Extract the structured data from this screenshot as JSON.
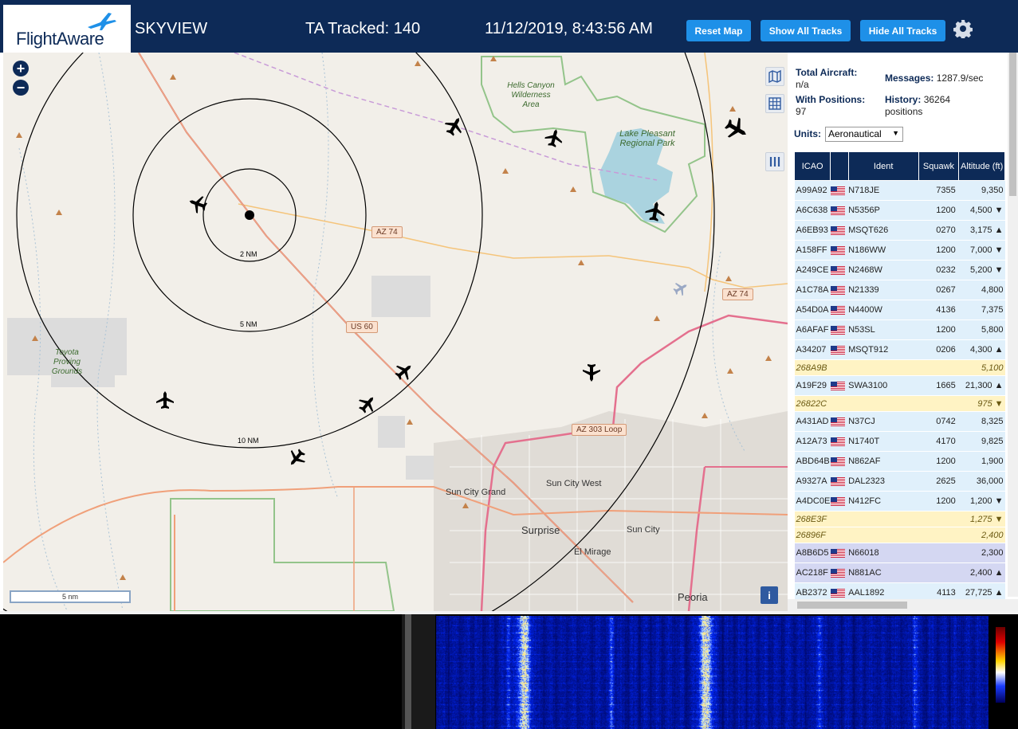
{
  "header": {
    "logo_text": "FlightAware",
    "title": "SKYVIEW",
    "tracked": "TA Tracked: 140",
    "datetime": "11/12/2019, 8:43:56 AM",
    "reset_map": "Reset Map",
    "show_all": "Show All Tracks",
    "hide_all": "Hide All Tracks"
  },
  "map": {
    "zoom_in": "+",
    "zoom_out": "−",
    "ring_labels": [
      "2 NM",
      "5 NM",
      "10 NM"
    ],
    "shields": [
      "AZ 74",
      "AZ 74",
      "US 60",
      "AZ 303 Loop"
    ],
    "places": [
      "Sun City Grand",
      "Sun City West",
      "Surprise",
      "Sun City",
      "El Mirage",
      "Peoria"
    ],
    "parks": [
      "Hells Canyon Wilderness Area",
      "Lake Pleasant Regional Park",
      "Toyota Proving Grounds"
    ],
    "scale_label": "5 nm",
    "info": "i"
  },
  "stats": {
    "total_label": "Total Aircraft:",
    "total_value": "n/a",
    "messages_label": "Messages:",
    "messages_value": "1287.9/sec",
    "positions_label": "With Positions:",
    "positions_value": "97",
    "history_label": "History:",
    "history_value": "36264 positions"
  },
  "units": {
    "label": "Units:",
    "value": "Aeronautical"
  },
  "table": {
    "headers": [
      "ICAO",
      "",
      "Ident",
      "Squawk",
      "Altitude (ft)"
    ],
    "rows": [
      {
        "icao": "A99A92",
        "ident": "N718JE",
        "squawk": "7355",
        "alt": "9,350",
        "type": "blue",
        "flag": true
      },
      {
        "icao": "A6C638",
        "ident": "N5356P",
        "squawk": "1200",
        "alt": "4,500 ▼",
        "type": "blue",
        "flag": true
      },
      {
        "icao": "A6EB93",
        "ident": "MSQT626",
        "squawk": "0270",
        "alt": "3,175 ▲",
        "type": "blue",
        "flag": true
      },
      {
        "icao": "A158FF",
        "ident": "N186WW",
        "squawk": "1200",
        "alt": "7,000 ▼",
        "type": "blue",
        "flag": true
      },
      {
        "icao": "A249CE",
        "ident": "N2468W",
        "squawk": "0232",
        "alt": "5,200 ▼",
        "type": "blue",
        "flag": true
      },
      {
        "icao": "A1C78A",
        "ident": "N21339",
        "squawk": "0267",
        "alt": "4,800",
        "type": "blue",
        "flag": true
      },
      {
        "icao": "A54D0A",
        "ident": "N4400W",
        "squawk": "4136",
        "alt": "7,375",
        "type": "blue",
        "flag": true
      },
      {
        "icao": "A6AFAF",
        "ident": "N53SL",
        "squawk": "1200",
        "alt": "5,800",
        "type": "blue",
        "flag": true
      },
      {
        "icao": "A34207",
        "ident": "MSQT912",
        "squawk": "0206",
        "alt": "4,300 ▲",
        "type": "blue",
        "flag": true
      },
      {
        "icao": "268A9B",
        "ident": "",
        "squawk": "",
        "alt": "5,100",
        "type": "yellow",
        "flag": false
      },
      {
        "icao": "A19F29",
        "ident": "SWA3100",
        "squawk": "1665",
        "alt": "21,300 ▲",
        "type": "blue",
        "flag": true
      },
      {
        "icao": "26822C",
        "ident": "",
        "squawk": "",
        "alt": "975 ▼",
        "type": "yellow",
        "flag": false
      },
      {
        "icao": "A431AD",
        "ident": "N37CJ",
        "squawk": "0742",
        "alt": "8,325",
        "type": "blue",
        "flag": true
      },
      {
        "icao": "A12A73",
        "ident": "N1740T",
        "squawk": "4170",
        "alt": "9,825",
        "type": "blue",
        "flag": true
      },
      {
        "icao": "ABD64B",
        "ident": "N862AF",
        "squawk": "1200",
        "alt": "1,900",
        "type": "blue",
        "flag": true
      },
      {
        "icao": "A9327A",
        "ident": "DAL2323",
        "squawk": "2625",
        "alt": "36,000",
        "type": "blue",
        "flag": true
      },
      {
        "icao": "A4DC0E",
        "ident": "N412FC",
        "squawk": "1200",
        "alt": "1,200 ▼",
        "type": "blue",
        "flag": true
      },
      {
        "icao": "268E3F",
        "ident": "",
        "squawk": "",
        "alt": "1,275 ▼",
        "type": "yellow",
        "flag": false
      },
      {
        "icao": "26896F",
        "ident": "",
        "squawk": "",
        "alt": "2,400",
        "type": "yellow",
        "flag": false
      },
      {
        "icao": "A8B6D5",
        "ident": "N66018",
        "squawk": "",
        "alt": "2,300",
        "type": "purple",
        "flag": true
      },
      {
        "icao": "AC218F",
        "ident": "N881AC",
        "squawk": "",
        "alt": "2,400 ▲",
        "type": "purple",
        "flag": true
      },
      {
        "icao": "AB2372",
        "ident": "AAL1892",
        "squawk": "4113",
        "alt": "27,725 ▲",
        "type": "blue",
        "flag": true
      }
    ]
  },
  "colors": {
    "header": "#0d2a57",
    "button": "#1e90e8",
    "row_blue": "#e0f0fb",
    "row_yellow": "#fff3c4",
    "row_purple": "#d4d7f2"
  }
}
